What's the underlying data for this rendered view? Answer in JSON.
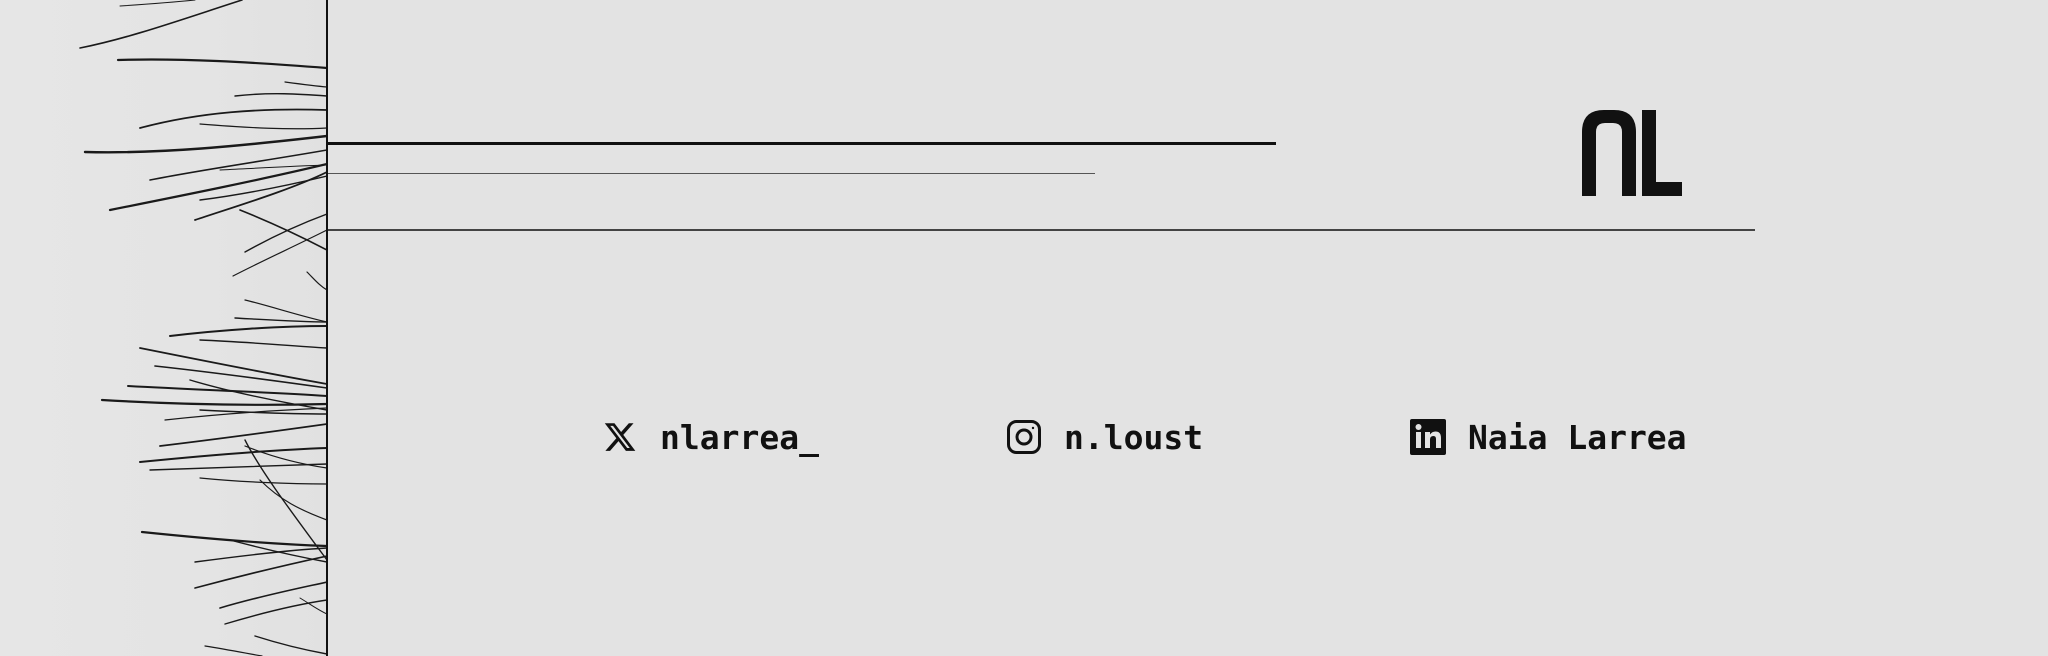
{
  "banner": {
    "logo": {
      "text": "NL",
      "icon": "nl-monogram-logo"
    },
    "socials": [
      {
        "platform": "x",
        "icon": "x-icon",
        "handle": "nlarrea_"
      },
      {
        "platform": "instagram",
        "icon": "instagram-icon",
        "handle": "n.loust"
      },
      {
        "platform": "linkedin",
        "icon": "linkedin-icon",
        "handle": "Naia Larrea"
      }
    ]
  },
  "colors": {
    "background": "#e3e3e3",
    "ink": "#111111",
    "line_light": "#555555"
  }
}
